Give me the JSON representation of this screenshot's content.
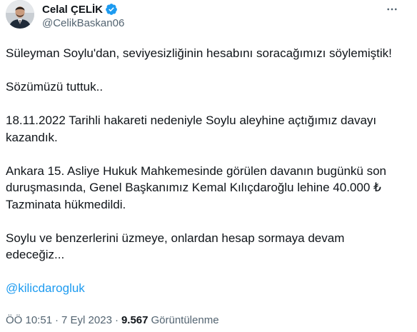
{
  "author": {
    "display_name": "Celal ÇELİK",
    "handle": "@CelikBaskan06",
    "verified": true,
    "avatar_icon": "profile-photo"
  },
  "tweet": {
    "paragraphs": [
      "Süleyman Soylu'dan, seviyesizliğinin hesabını soracağımızı söylemiştik!",
      "Sözümüzü tuttuk..",
      "18.11.2022 Tarihli hakareti nedeniyle Soylu aleyhine açtığımız davayı kazandık.",
      "Ankara 15. Asliye Hukuk Mahkemesinde görülen davanın bugünkü son duruşmasında, Genel Başkanımız Kemal Kılıçdaroğlu lehine 40.000 ₺ Tazminata hükmedildi.",
      "Soylu ve benzerlerini üzmeye, onlardan hesap sormaya devam edeceğiz..."
    ],
    "mention": "@kilicdarogluk"
  },
  "meta": {
    "time": "ÖÖ 10:51",
    "separator": "·",
    "date": "7 Eyl 2023",
    "views_count": "9.567",
    "views_label": "Görüntülenme"
  },
  "colors": {
    "accent": "#1d9bf0",
    "text": "#0f1419",
    "secondary": "#536471"
  }
}
